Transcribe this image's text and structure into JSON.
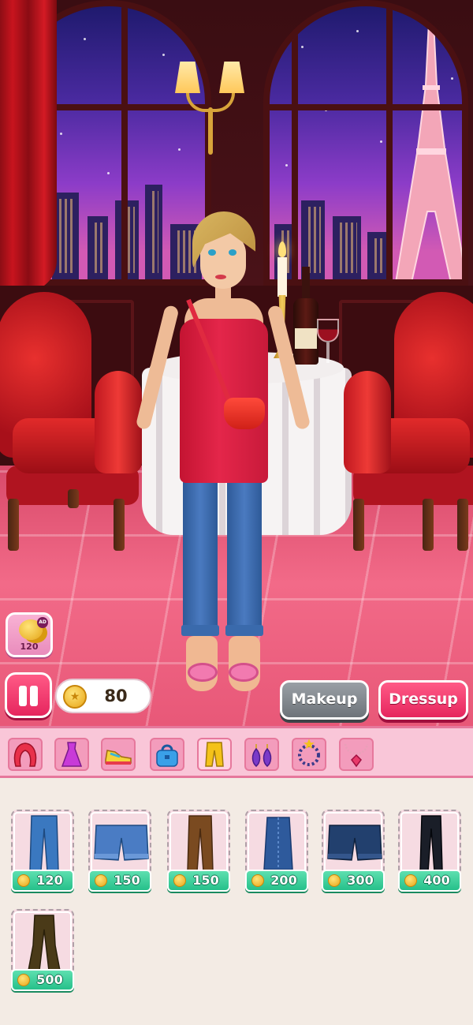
{
  "hud": {
    "ad_reward": {
      "badge": "AD",
      "amount": "120",
      "icon": "coin-stack-icon"
    },
    "pause": {
      "icon": "pause-icon"
    },
    "coins": {
      "icon": "star-coin-icon",
      "value": "80"
    },
    "modes": {
      "makeup_label": "Makeup",
      "dressup_label": "Dressup",
      "active": "Dressup"
    }
  },
  "categories": [
    {
      "name": "hair",
      "icon": "hair-icon",
      "active": false
    },
    {
      "name": "dress",
      "icon": "dress-icon",
      "active": false
    },
    {
      "name": "shoes",
      "icon": "sneaker-icon",
      "active": false
    },
    {
      "name": "bag",
      "icon": "handbag-icon",
      "active": false
    },
    {
      "name": "pants",
      "icon": "pants-icon",
      "active": true
    },
    {
      "name": "earrings",
      "icon": "earrings-icon",
      "active": false
    },
    {
      "name": "bracelet",
      "icon": "bracelet-icon",
      "active": false
    },
    {
      "name": "necklace",
      "icon": "necklace-icon",
      "active": false
    }
  ],
  "items": [
    {
      "kind": "blue jeans",
      "price": "120",
      "color": "#3a78c0"
    },
    {
      "kind": "denim shorts",
      "price": "150",
      "color": "#4a7cc4"
    },
    {
      "kind": "brown trousers",
      "price": "150",
      "color": "#7a4a20"
    },
    {
      "kind": "denim skirt",
      "price": "200",
      "color": "#2e5a9c"
    },
    {
      "kind": "dark denim shorts",
      "price": "300",
      "color": "#22406e"
    },
    {
      "kind": "black trousers",
      "price": "400",
      "color": "#1a1e28"
    },
    {
      "kind": "olive flared pants",
      "price": "500",
      "color": "#4a3a18"
    }
  ],
  "colors": {
    "accent_pink": "#e6265e",
    "price_green": "#26c08a",
    "category_bar": "#f9c6d8"
  }
}
